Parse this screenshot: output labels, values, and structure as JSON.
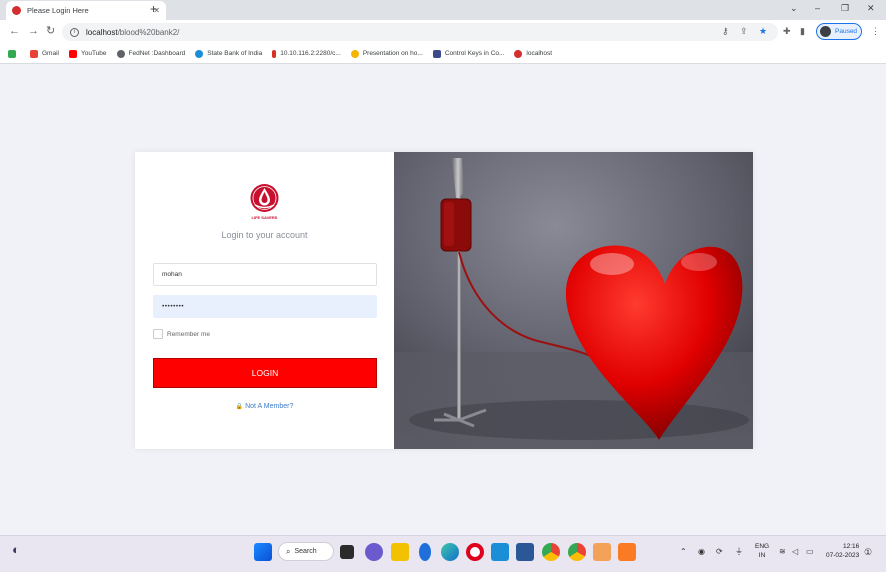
{
  "browser": {
    "tab_title": "Please Login Here",
    "tab_close": "✕",
    "new_tab": "+",
    "url_host": "localhost",
    "url_path": "/blood%20bank2/",
    "profile_status": "Paused"
  },
  "bookmarks": [
    {
      "label": "",
      "color": "#34a853"
    },
    {
      "label": "Gmail",
      "color": "#ea4335"
    },
    {
      "label": "YouTube",
      "color": "#ff0000"
    },
    {
      "label": "FedNet :Dashboard",
      "color": "#5f6368"
    },
    {
      "label": "State Bank of India",
      "color": "#1a8fd8"
    },
    {
      "label": "10.10.116.2:2280/c...",
      "color": "#d93025"
    },
    {
      "label": "Presentation on ho...",
      "color": "#f4b400"
    },
    {
      "label": "Control Keys in Co...",
      "color": "#3c4a8a"
    },
    {
      "label": "localhost",
      "color": "#d32f2f"
    }
  ],
  "login": {
    "logo_text": "LIFE SAVERS",
    "subtitle": "Login to your account",
    "username_value": "mohan",
    "password_value": "••••••••",
    "remember_label": "Remember me",
    "login_button": "LOGIN",
    "member_link": "Not A Member?"
  },
  "taskbar": {
    "search_label": "Search",
    "lang_line1": "ENG",
    "lang_line2": "IN",
    "time": "12:16",
    "date": "07-02-2023"
  },
  "colors": {
    "accent_red": "#ff0000",
    "link_blue": "#3f7cc7",
    "chrome_blue": "#1a73e8"
  }
}
